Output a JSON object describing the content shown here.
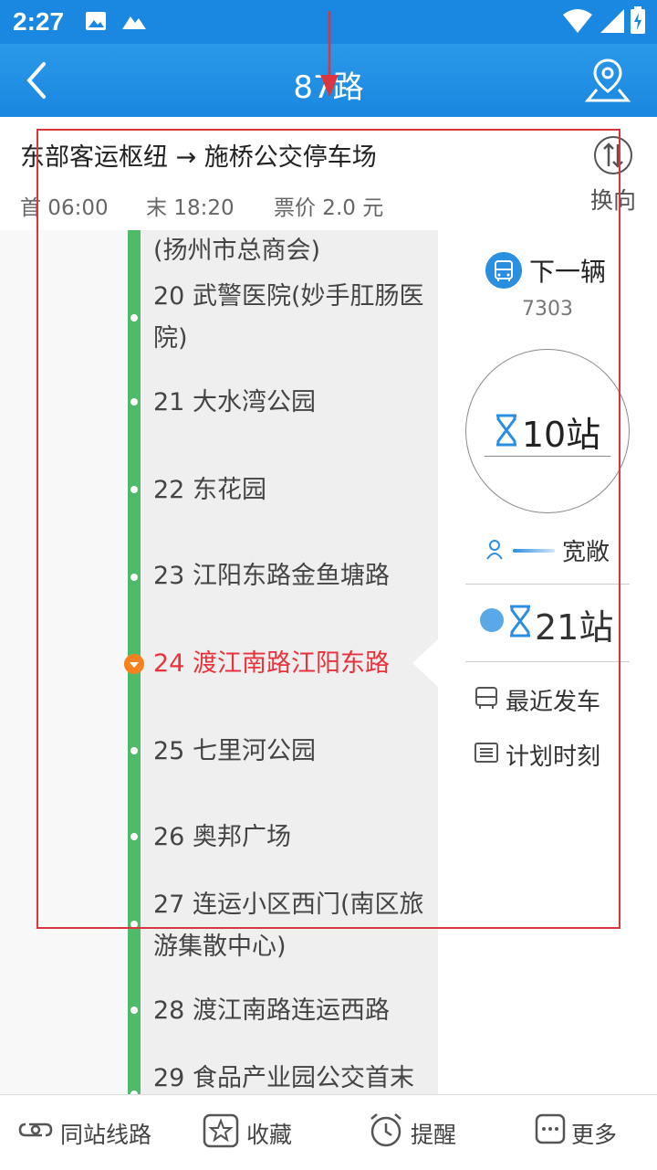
{
  "statusbar": {
    "time": "2:27"
  },
  "appbar": {
    "title": "87路"
  },
  "route": {
    "direction": "东部客运枢纽 → 施桥公交停车场",
    "first_bus": "首 06:00",
    "last_bus": "末 18:20",
    "fare": "票价 2.0 元",
    "swap_label": "换向"
  },
  "stations": [
    {
      "text": "(扬州市总商会)"
    },
    {
      "text": "20 武警医院(妙手肛肠医院)"
    },
    {
      "text": "21 大水湾公园"
    },
    {
      "text": "22 东花园"
    },
    {
      "text": "23 江阳东路金鱼塘路"
    },
    {
      "text": "24 渡江南路江阳东路"
    },
    {
      "text": "25 七里河公园"
    },
    {
      "text": "26 奥邦广场"
    },
    {
      "text": "27 连运小区西门(南区旅游集散中心)"
    },
    {
      "text": "28 渡江南路连运西路"
    },
    {
      "text": "29 食品产业园公交首末"
    }
  ],
  "panel": {
    "next_bus_label": "下一辆",
    "plate": "7303",
    "next_stops": "10站",
    "crowd": "宽敞",
    "second_stops": "21站",
    "recent_departure": "最近发车",
    "schedule": "计划时刻"
  },
  "tabs": {
    "same_station": "同站线路",
    "favorite": "收藏",
    "reminder": "提醒",
    "more": "更多"
  },
  "colors": {
    "header": "#1a87e0",
    "rail": "#4dbb6a",
    "current_station": "#e8333c",
    "highlight_box": "#d9363e"
  }
}
